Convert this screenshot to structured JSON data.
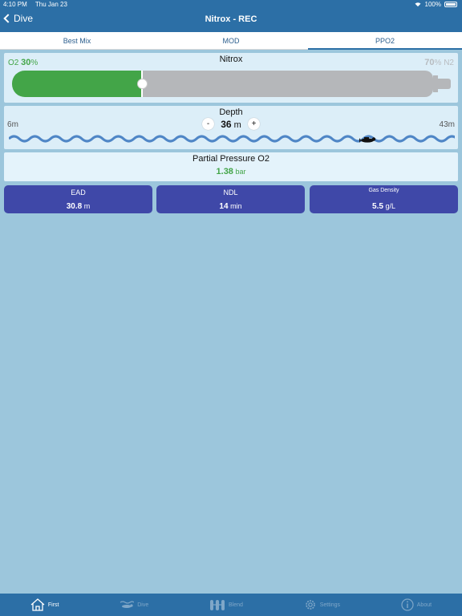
{
  "status": {
    "time": "4:10 PM",
    "date": "Thu Jan 23",
    "battery": "100%"
  },
  "nav": {
    "back_label": "Dive",
    "title": "Nitrox - REC"
  },
  "tabs": [
    {
      "label": "Best Mix",
      "active": false
    },
    {
      "label": "MOD",
      "active": false
    },
    {
      "label": "PPO2",
      "active": true
    }
  ],
  "mix": {
    "title": "Nitrox",
    "o2_name": "O2",
    "o2_value": "30",
    "o2_unit": "%",
    "n2_name": "N2",
    "n2_value": "70",
    "n2_unit": "%",
    "o2_fraction": 0.3,
    "colors": {
      "o2": "#43a548",
      "n2": "#b5b7ba"
    }
  },
  "depth": {
    "title": "Depth",
    "min": "6",
    "max": "43",
    "unit": "m",
    "value": "36",
    "value_unit": "m",
    "minus": "-",
    "plus": "+"
  },
  "ppo2": {
    "title": "Partial Pressure O2",
    "value": "1.38",
    "unit": "bar"
  },
  "cards": [
    {
      "title": "EAD",
      "value": "30.8",
      "unit": "m"
    },
    {
      "title": "NDL",
      "value": "14",
      "unit": "min"
    },
    {
      "title": "Gas Density",
      "value": "5.5",
      "unit": "g/L"
    }
  ],
  "tabbar": [
    {
      "label": "First",
      "icon": "home-icon",
      "active": true
    },
    {
      "label": "Dive",
      "icon": "dive-icon",
      "active": false
    },
    {
      "label": "Blend",
      "icon": "blend-icon",
      "active": false
    },
    {
      "label": "Settings",
      "icon": "gear-icon",
      "active": false
    },
    {
      "label": "About",
      "icon": "info-icon",
      "active": false
    }
  ]
}
